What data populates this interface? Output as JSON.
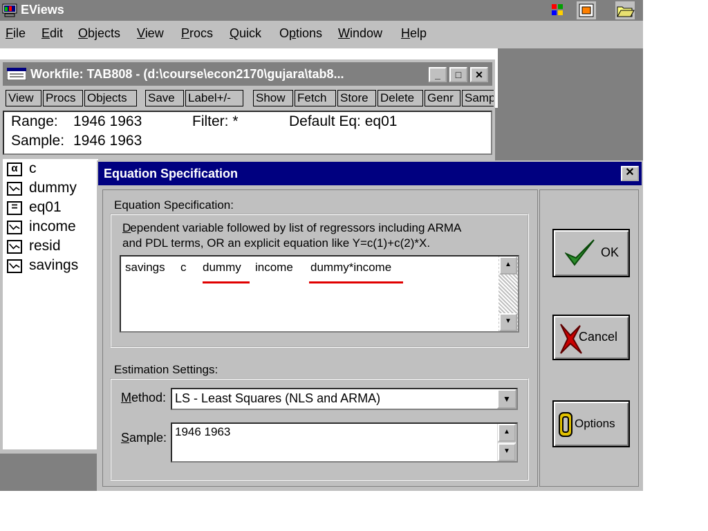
{
  "app": {
    "title": "EViews",
    "menu": [
      "File",
      "Edit",
      "Objects",
      "View",
      "Procs",
      "Quick",
      "Options",
      "Window",
      "Help"
    ],
    "menu_mnemonics": [
      "F",
      "E",
      "O",
      "V",
      "P",
      "Q",
      "p",
      "W",
      "H"
    ]
  },
  "workfile": {
    "title": "Workfile: TAB808 - (d:\\course\\econ2170\\gujara\\tab8...",
    "toolbar": [
      "View",
      "Procs",
      "Objects",
      "Save",
      "Label+/-",
      "Show",
      "Fetch",
      "Store",
      "Delete",
      "Genr",
      "Samp"
    ],
    "range_label": "Range:",
    "range_value": "1946 1963",
    "filter_label": "Filter: *",
    "default_eq_label": "Default Eq: eq01",
    "sample_label": "Sample:",
    "sample_value": "1946 1963",
    "objects": [
      {
        "name": "c",
        "icon": "alpha-icon"
      },
      {
        "name": "dummy",
        "icon": "series-icon"
      },
      {
        "name": "eq01",
        "icon": "equation-icon"
      },
      {
        "name": "income",
        "icon": "series-icon"
      },
      {
        "name": "resid",
        "icon": "series-icon"
      },
      {
        "name": "savings",
        "icon": "series-icon"
      }
    ]
  },
  "dialog": {
    "title": "Equation Specification",
    "spec_group_label": "Equation Specification:",
    "help_line1": "Dependent variable followed by list of regressors including ARMA",
    "help_line2": "and PDL terms, OR an explicit equation like Y=c(1)+c(2)*X.",
    "equation_tokens": [
      "savings",
      "c",
      "dummy",
      "income",
      "dummy*income"
    ],
    "estimation_group_label": "Estimation Settings:",
    "method_label": "Method:",
    "method_value": "LS  -  Least Squares (NLS and ARMA)",
    "sample_label": "Sample:",
    "sample_value": "1946 1963",
    "ok_label": "OK",
    "cancel_label": "Cancel",
    "options_label": "Options",
    "close_glyph": "✕"
  },
  "colors": {
    "title_active": "#000080",
    "title_inactive": "#808080",
    "face": "#c0c0c0",
    "highlight_underline": "#e00000",
    "ok_check": "#2a8a2a",
    "cancel_x": "#cc0000",
    "options_icon": "#e0c000"
  }
}
